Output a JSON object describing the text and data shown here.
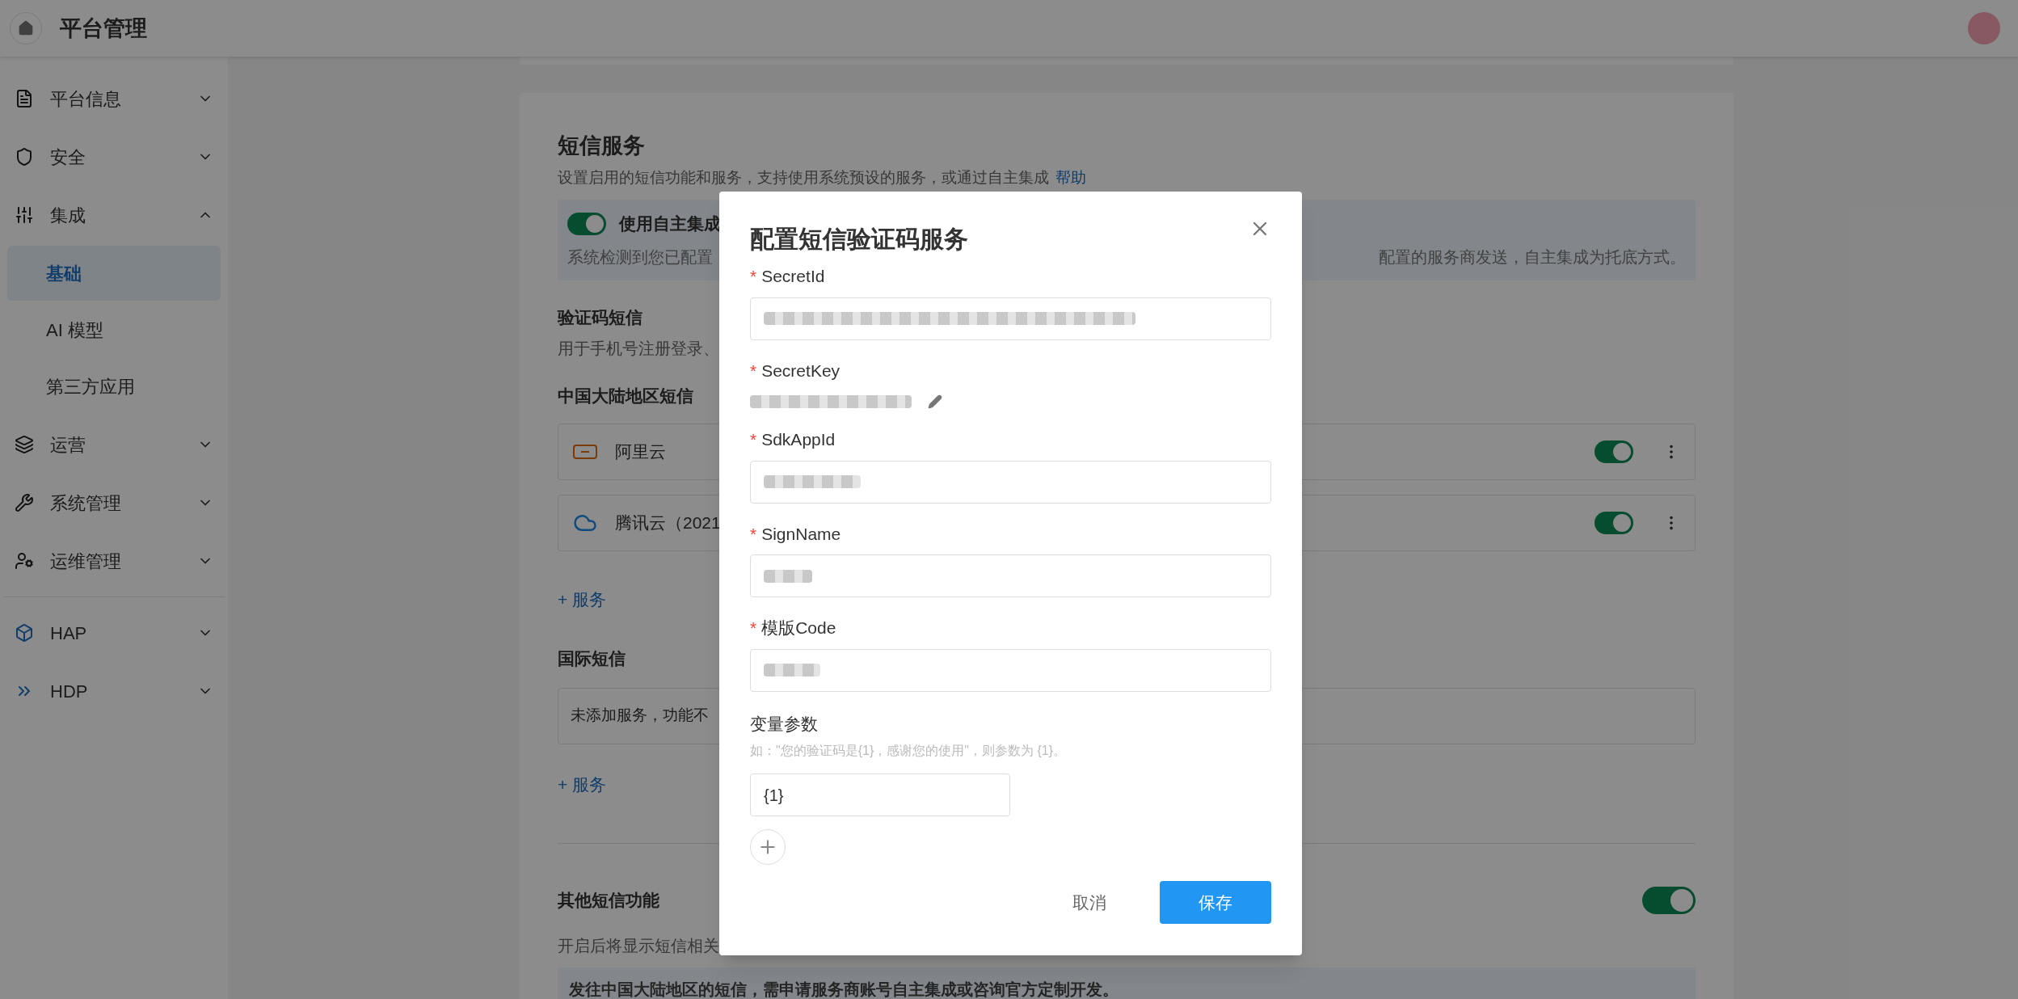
{
  "header": {
    "title": "平台管理"
  },
  "sidebar": {
    "items": [
      {
        "label": "平台信息",
        "expanded": false
      },
      {
        "label": "安全",
        "expanded": false
      },
      {
        "label": "集成",
        "expanded": true,
        "children": [
          {
            "label": "基础",
            "selected": true
          },
          {
            "label": "AI 模型",
            "selected": false
          },
          {
            "label": "第三方应用",
            "selected": false
          }
        ]
      },
      {
        "label": "运营",
        "expanded": false
      },
      {
        "label": "系统管理",
        "expanded": false
      },
      {
        "label": "运维管理",
        "expanded": false
      },
      {
        "label": "HAP",
        "expanded": false
      },
      {
        "label": "HDP",
        "expanded": false
      }
    ]
  },
  "sms": {
    "title": "短信服务",
    "description": "设置启用的短信功能和服务，支持使用系统预设的服务，或通过自主集成",
    "help_link": "帮助",
    "self_integration": {
      "on": true,
      "label": "使用自主集成",
      "description_start": "系统检测到您已配置",
      "description_end": "配置的服务商发送，自主集成为托底方式。"
    },
    "verification": {
      "title": "验证码短信",
      "description": "用于手机号注册登录、"
    },
    "mainland": {
      "title": "中国大陆地区短信",
      "providers": [
        {
          "name": "阿里云",
          "on": true
        },
        {
          "name": "腾讯云（2021",
          "on": true
        }
      ],
      "add_link": "+ 服务"
    },
    "international": {
      "title": "国际短信",
      "empty_text": "未添加服务，功能不",
      "add_link": "+ 服务"
    },
    "other": {
      "title": "其他短信功能",
      "on": true,
      "description": "开启后将显示短信相关",
      "notice": "发往中国大陆地区的短信，需申请服务商账号自主集成或咨询官方定制开发。"
    }
  },
  "dialog": {
    "title": "配置短信验证码服务",
    "required_mark": "*",
    "fields": [
      {
        "label": "SecretId",
        "required": true,
        "kind": "input"
      },
      {
        "label": "SecretKey",
        "required": true,
        "kind": "secret"
      },
      {
        "label": "SdkAppId",
        "required": true,
        "kind": "input"
      },
      {
        "label": "SignName",
        "required": true,
        "kind": "input"
      },
      {
        "label": "模版Code",
        "required": true,
        "kind": "input"
      }
    ],
    "variables": {
      "label": "变量参数",
      "hint": "如：\"您的验证码是{1}，感谢您的使用\"，则参数为 {1}。",
      "values": [
        "{1}"
      ]
    },
    "cancel": "取消",
    "save": "保存"
  }
}
